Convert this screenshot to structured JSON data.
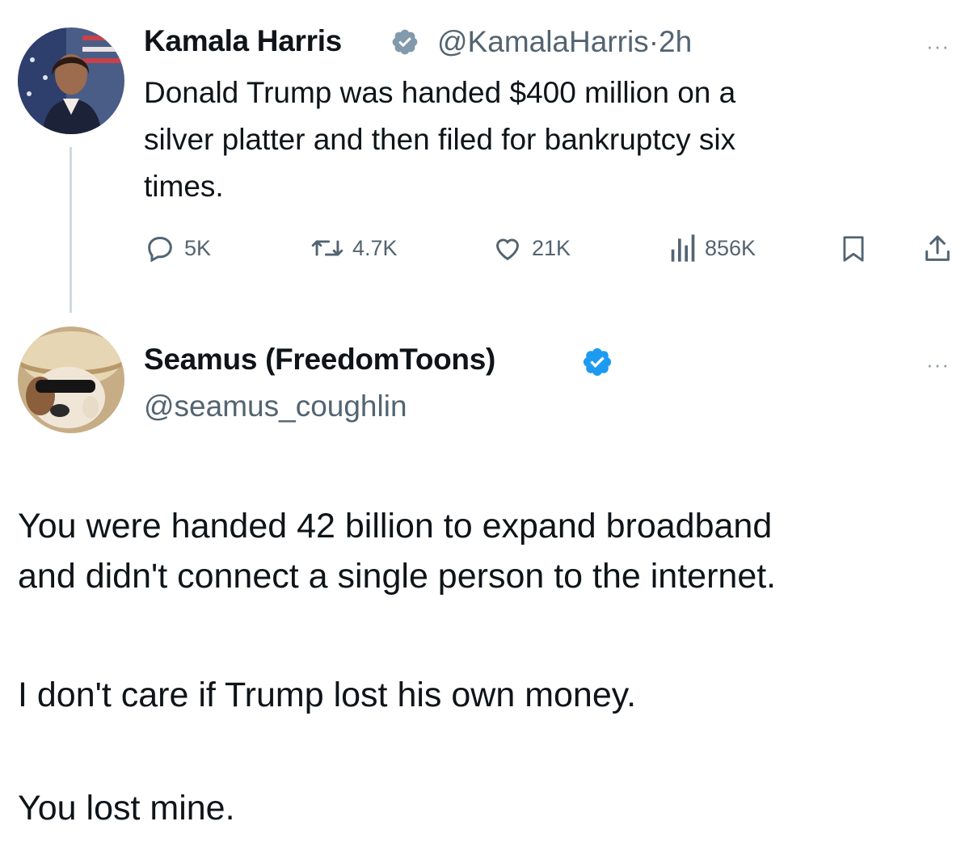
{
  "tweet": {
    "author_name": "Kamala Harris",
    "handle": "@KamalaHarris",
    "separator": "·",
    "time": "2h",
    "more_icon": "more-dots-icon",
    "text_lines": [
      "Donald Trump was handed $400 million on a",
      "silver platter and then filed for bankruptcy six",
      "times."
    ],
    "actions": {
      "replies": "5K",
      "reposts": "4.7K",
      "likes": "21K",
      "views": "856K"
    },
    "verified_badge_color": "#829aab"
  },
  "reply": {
    "author_name": "Seamus (FreedomToons)",
    "handle": "@seamus_coughlin",
    "verified_badge_color": "#1d9bf0",
    "paragraphs": [
      "You were handed 42 billion to expand broadband",
      "and didn't connect a single person to the internet.",
      "I don't care if Trump lost his own money.",
      "You lost mine."
    ]
  },
  "colors": {
    "text": "#0f1419",
    "secondary": "#536471",
    "thread_line": "#cfd9de"
  }
}
